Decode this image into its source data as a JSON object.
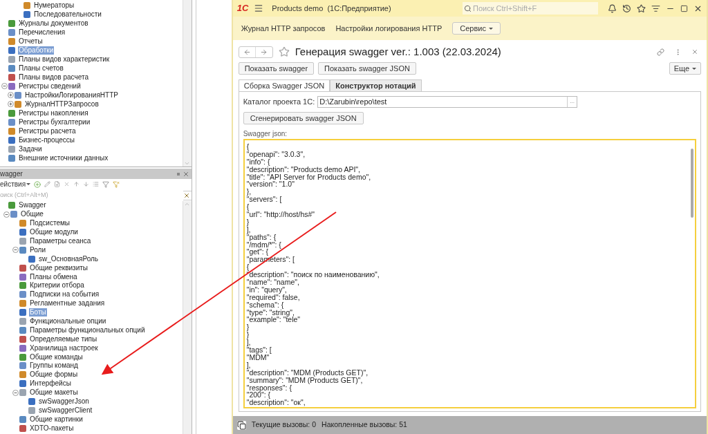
{
  "configuration_tree": {
    "continued_items": [
      {
        "label": "Нумераторы",
        "selected": false
      },
      {
        "label": "Последовательности",
        "selected": false
      }
    ],
    "items": [
      {
        "label": "Журналы документов",
        "selected": false
      },
      {
        "label": "Перечисления",
        "selected": false
      },
      {
        "label": "Отчеты",
        "selected": false
      },
      {
        "label": "Обработки",
        "selected": true
      },
      {
        "label": "Планы видов характеристик",
        "selected": false
      },
      {
        "label": "Планы счетов",
        "selected": false
      },
      {
        "label": "Планы видов расчета",
        "selected": false
      },
      {
        "label": "Регистры сведений",
        "selected": false,
        "expanded": true,
        "children": [
          {
            "label": "НастройкиЛогированияHTTP",
            "selected": false,
            "expanded": false
          },
          {
            "label": "ЖурналHTTPЗапросов",
            "selected": false,
            "expanded": false
          }
        ]
      },
      {
        "label": "Регистры накопления",
        "selected": false
      },
      {
        "label": "Регистры бухгалтерии",
        "selected": false
      },
      {
        "label": "Регистры расчета",
        "selected": false
      },
      {
        "label": "Бизнес-процессы",
        "selected": false
      },
      {
        "label": "Задачи",
        "selected": false
      },
      {
        "label": "Внешние источники данных",
        "selected": false
      }
    ]
  },
  "subsystem_panel": {
    "title": "wagger",
    "actions_label": "ействия",
    "search": {
      "placeholder": "оиск (Ctrl+Alt+M)"
    },
    "tree": [
      {
        "label": "Swagger",
        "selected": false,
        "children": [
          {
            "label": "Общие",
            "selected": false,
            "expanded": true,
            "children": [
              {
                "label": "Подсистемы",
                "selected": false
              },
              {
                "label": "Общие модули",
                "selected": false
              },
              {
                "label": "Параметры сеанса",
                "selected": false
              },
              {
                "label": "Роли",
                "selected": false,
                "expanded": true,
                "children": [
                  {
                    "label": "sw_ОсновнаяРоль",
                    "selected": false
                  }
                ]
              },
              {
                "label": "Общие реквизиты",
                "selected": false
              },
              {
                "label": "Планы обмена",
                "selected": false
              },
              {
                "label": "Критерии отбора",
                "selected": false
              },
              {
                "label": "Подписки на события",
                "selected": false
              },
              {
                "label": "Регламентные задания",
                "selected": false
              },
              {
                "label": "Боты",
                "selected": true
              },
              {
                "label": "Функциональные опции",
                "selected": false
              },
              {
                "label": "Параметры функциональных опций",
                "selected": false
              },
              {
                "label": "Определяемые типы",
                "selected": false
              },
              {
                "label": "Хранилища настроек",
                "selected": false
              },
              {
                "label": "Общие команды",
                "selected": false
              },
              {
                "label": "Группы команд",
                "selected": false
              },
              {
                "label": "Общие формы",
                "selected": false
              },
              {
                "label": "Интерфейсы",
                "selected": false
              },
              {
                "label": "Общие макеты",
                "selected": false,
                "expanded": true,
                "children": [
                  {
                    "label": "swSwaggerJson",
                    "selected": false
                  },
                  {
                    "label": "swSwaggerClient",
                    "selected": false
                  }
                ]
              },
              {
                "label": "Общие картинки",
                "selected": false
              },
              {
                "label": "XDTO-пакеты",
                "selected": false
              }
            ]
          }
        ]
      }
    ]
  },
  "app_window": {
    "logo": "1С",
    "title": "Products demo  (1С:Предприятие)",
    "search": {
      "placeholder": "Поиск Ctrl+Shift+F"
    },
    "sections": [
      "Журнал HTTP запросов",
      "Настройки логирования HTTP"
    ],
    "service_menu": "Сервис",
    "form": {
      "title": "Генерация swagger ver.: 1.003 (22.03.2024)",
      "buttons": [
        "Показать swagger",
        "Показать swagger JSON"
      ],
      "more_menu": "Еще",
      "tabs": [
        {
          "label": "Сборка Swagger JSON",
          "selected": true
        },
        {
          "label": "Конструктор нотаций",
          "selected": false
        }
      ],
      "catalog": {
        "label": "Каталог проекта 1С:",
        "value": "D:\\Zarubin\\repo\\test",
        "browse": "..."
      },
      "generate_button": "Сгенерировать swagger JSON",
      "json_label": "Swagger json:",
      "json_lines": [
        "{",
        "\"openapi\": \"3.0.3\",",
        "\"info\": {",
        "\"description\": \"Products demo API\",",
        "\"title\": \"API Server for Products demo\",",
        "\"version\": \"1.0\"",
        "},",
        "\"servers\": [",
        "{",
        "\"url\": \"http://host/hs#\"",
        "}",
        "],",
        "\"paths\": {",
        "\"/mdm/*\": {",
        "\"get\": {",
        "\"parameters\": [",
        "{",
        "\"description\": \"поиск по наименованию\",",
        "\"name\": \"name\",",
        "\"in\": \"query\",",
        "\"required\": false,",
        "\"schema\": {",
        "\"type\": \"string\",",
        "\"example\": \"tele\"",
        "}",
        "}",
        "],",
        "\"tags\": [",
        "\"MDM\"",
        "],",
        "\"description\": \"MDM (Products GET)\",",
        "\"summary\": \"MDM (Products GET)\",",
        "\"responses\": {",
        "\"200\": {",
        "\"description\": \"ок\","
      ]
    },
    "status_bar": [
      "Текущие вызовы: 0",
      "Накопленные вызовы: 51"
    ]
  }
}
